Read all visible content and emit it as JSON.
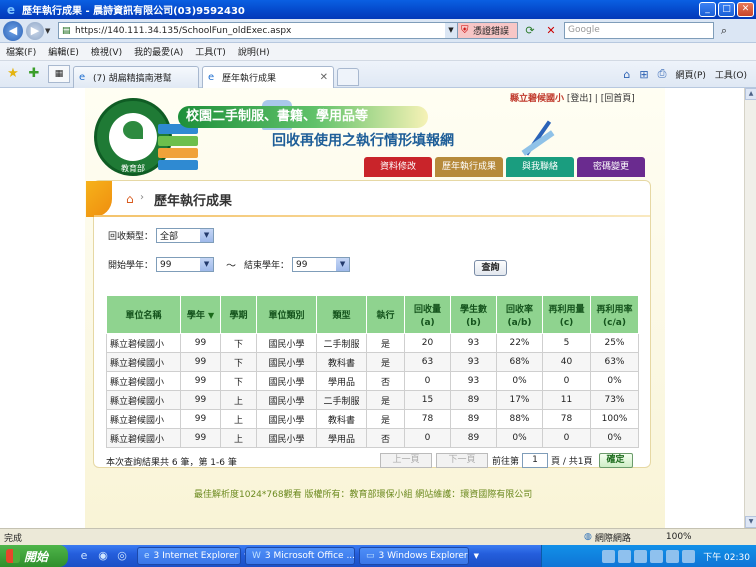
{
  "window": {
    "title": "歷年執行成果 - 晨詩資訊有限公司(03)9592430"
  },
  "addressbar": {
    "url": "https://140.111.34.135/SchoolFun_oldExec.aspx",
    "cert_error": "憑證錯誤",
    "search_placeholder": "Google"
  },
  "menu": [
    "檔案(F)",
    "編輯(E)",
    "檢視(V)",
    "我的最愛(A)",
    "工具(T)",
    "說明(H)"
  ],
  "tabs": [
    {
      "label": "(7) 胡扁精搞南港幫"
    },
    {
      "label": "歷年執行成果"
    }
  ],
  "commandbar": {
    "page": "網頁(P)",
    "tools": "工具(O)"
  },
  "header": {
    "seal_text": "教育部",
    "title_line1": "校園二手制服、書籍、學用品等",
    "title_line2": "回收再使用之執行情形填報網",
    "school": "縣立碧候國小",
    "logout": "[登出]",
    "home": "[回首頁]"
  },
  "navtabs": [
    {
      "label": "資料修改",
      "color": "#c9242a"
    },
    {
      "label": "歷年執行成果",
      "color": "#b68a3b"
    },
    {
      "label": "與我聯絡",
      "color": "#1a9d7f"
    },
    {
      "label": "密碼變更",
      "color": "#6a2b8f"
    }
  ],
  "panel": {
    "title": "歷年執行成果"
  },
  "filters": {
    "category_label": "回收類型：",
    "category_value": "全部",
    "start_label": "開始學年：",
    "start_value": "99",
    "tilde": "～",
    "end_label": "結束學年：",
    "end_value": "99",
    "query_button": "查詢"
  },
  "table": {
    "headers": [
      {
        "label": "單位名稱",
        "sub": ""
      },
      {
        "label": "學年",
        "sub": ""
      },
      {
        "label": "學期",
        "sub": ""
      },
      {
        "label": "單位類別",
        "sub": ""
      },
      {
        "label": "類型",
        "sub": ""
      },
      {
        "label": "執行",
        "sub": ""
      },
      {
        "label": "回收量",
        "sub": "(a)"
      },
      {
        "label": "學生數",
        "sub": "(b)"
      },
      {
        "label": "回收率",
        "sub": "(a/b)"
      },
      {
        "label": "再利用量",
        "sub": "(c)"
      },
      {
        "label": "再利用率",
        "sub": "(c/a)"
      }
    ],
    "rows": [
      [
        "縣立碧候國小",
        "99",
        "下",
        "國民小學",
        "二手制服",
        "是",
        "20",
        "93",
        "22%",
        "5",
        "25%"
      ],
      [
        "縣立碧候國小",
        "99",
        "下",
        "國民小學",
        "教科書",
        "是",
        "63",
        "93",
        "68%",
        "40",
        "63%"
      ],
      [
        "縣立碧候國小",
        "99",
        "下",
        "國民小學",
        "學用品",
        "否",
        "0",
        "93",
        "0%",
        "0",
        "0%"
      ],
      [
        "縣立碧候國小",
        "99",
        "上",
        "國民小學",
        "二手制服",
        "是",
        "15",
        "89",
        "17%",
        "11",
        "73%"
      ],
      [
        "縣立碧候國小",
        "99",
        "上",
        "國民小學",
        "教科書",
        "是",
        "78",
        "89",
        "88%",
        "78",
        "100%"
      ],
      [
        "縣立碧候國小",
        "99",
        "上",
        "國民小學",
        "學用品",
        "否",
        "0",
        "89",
        "0%",
        "0",
        "0%"
      ]
    ]
  },
  "results_info": "本次查詢結果共 6 筆，第 1-6 筆",
  "pager": {
    "prev": "上一頁",
    "next": "下一頁",
    "goto_label": "前往第",
    "page_value": "1",
    "of_label": "頁 / 共1頁",
    "ok": "確定"
  },
  "site_footer": "最佳解析度1024*768觀看 版權所有：教育部環保小組 網站維護：環資國際有限公司",
  "statusbar": {
    "status": "完成",
    "zone": "網際網路",
    "zoom": "100%"
  },
  "taskbar": {
    "start": "開始",
    "tasks": [
      {
        "label": "3 Internet Explorer"
      },
      {
        "label": "3 Microsoft Office ..."
      },
      {
        "label": "3 Windows Explorer"
      }
    ],
    "clock": "下午 02:30"
  }
}
